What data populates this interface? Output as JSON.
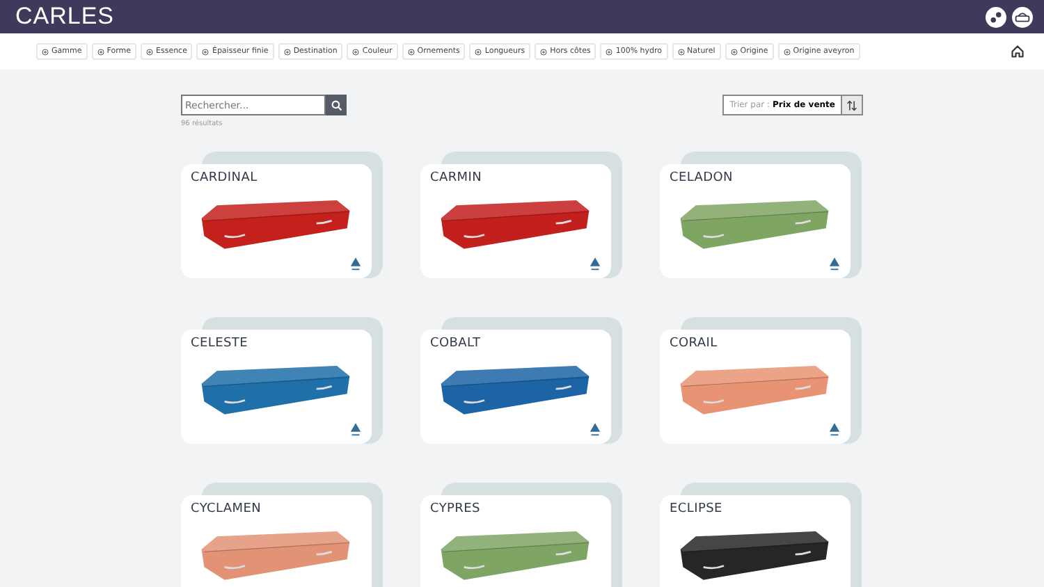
{
  "header": {
    "logo": "CARLES"
  },
  "filters": [
    "Gamme",
    "Forme",
    "Essence",
    "Épaisseur finie",
    "Destination",
    "Couleur",
    "Ornements",
    "Longueurs",
    "Hors côtes",
    "100% hydro",
    "Naturel",
    "Origine",
    "Origine aveyron"
  ],
  "search": {
    "placeholder": "Rechercher..."
  },
  "results": "96 résultats",
  "sort": {
    "label": "Trier par :",
    "value": "Prix de vente"
  },
  "products": [
    {
      "name": "CARDINAL",
      "color": "#c4201c"
    },
    {
      "name": "CARMIN",
      "color": "#c21f1d"
    },
    {
      "name": "CELADON",
      "color": "#7fa563"
    },
    {
      "name": "CELESTE",
      "color": "#1f6fa8"
    },
    {
      "name": "COBALT",
      "color": "#1d64a6"
    },
    {
      "name": "CORAIL",
      "color": "#e89474"
    },
    {
      "name": "CYCLAMEN",
      "color": "#e39375"
    },
    {
      "name": "CYPRES",
      "color": "#7fa564"
    },
    {
      "name": "ECLIPSE",
      "color": "#262626"
    }
  ]
}
